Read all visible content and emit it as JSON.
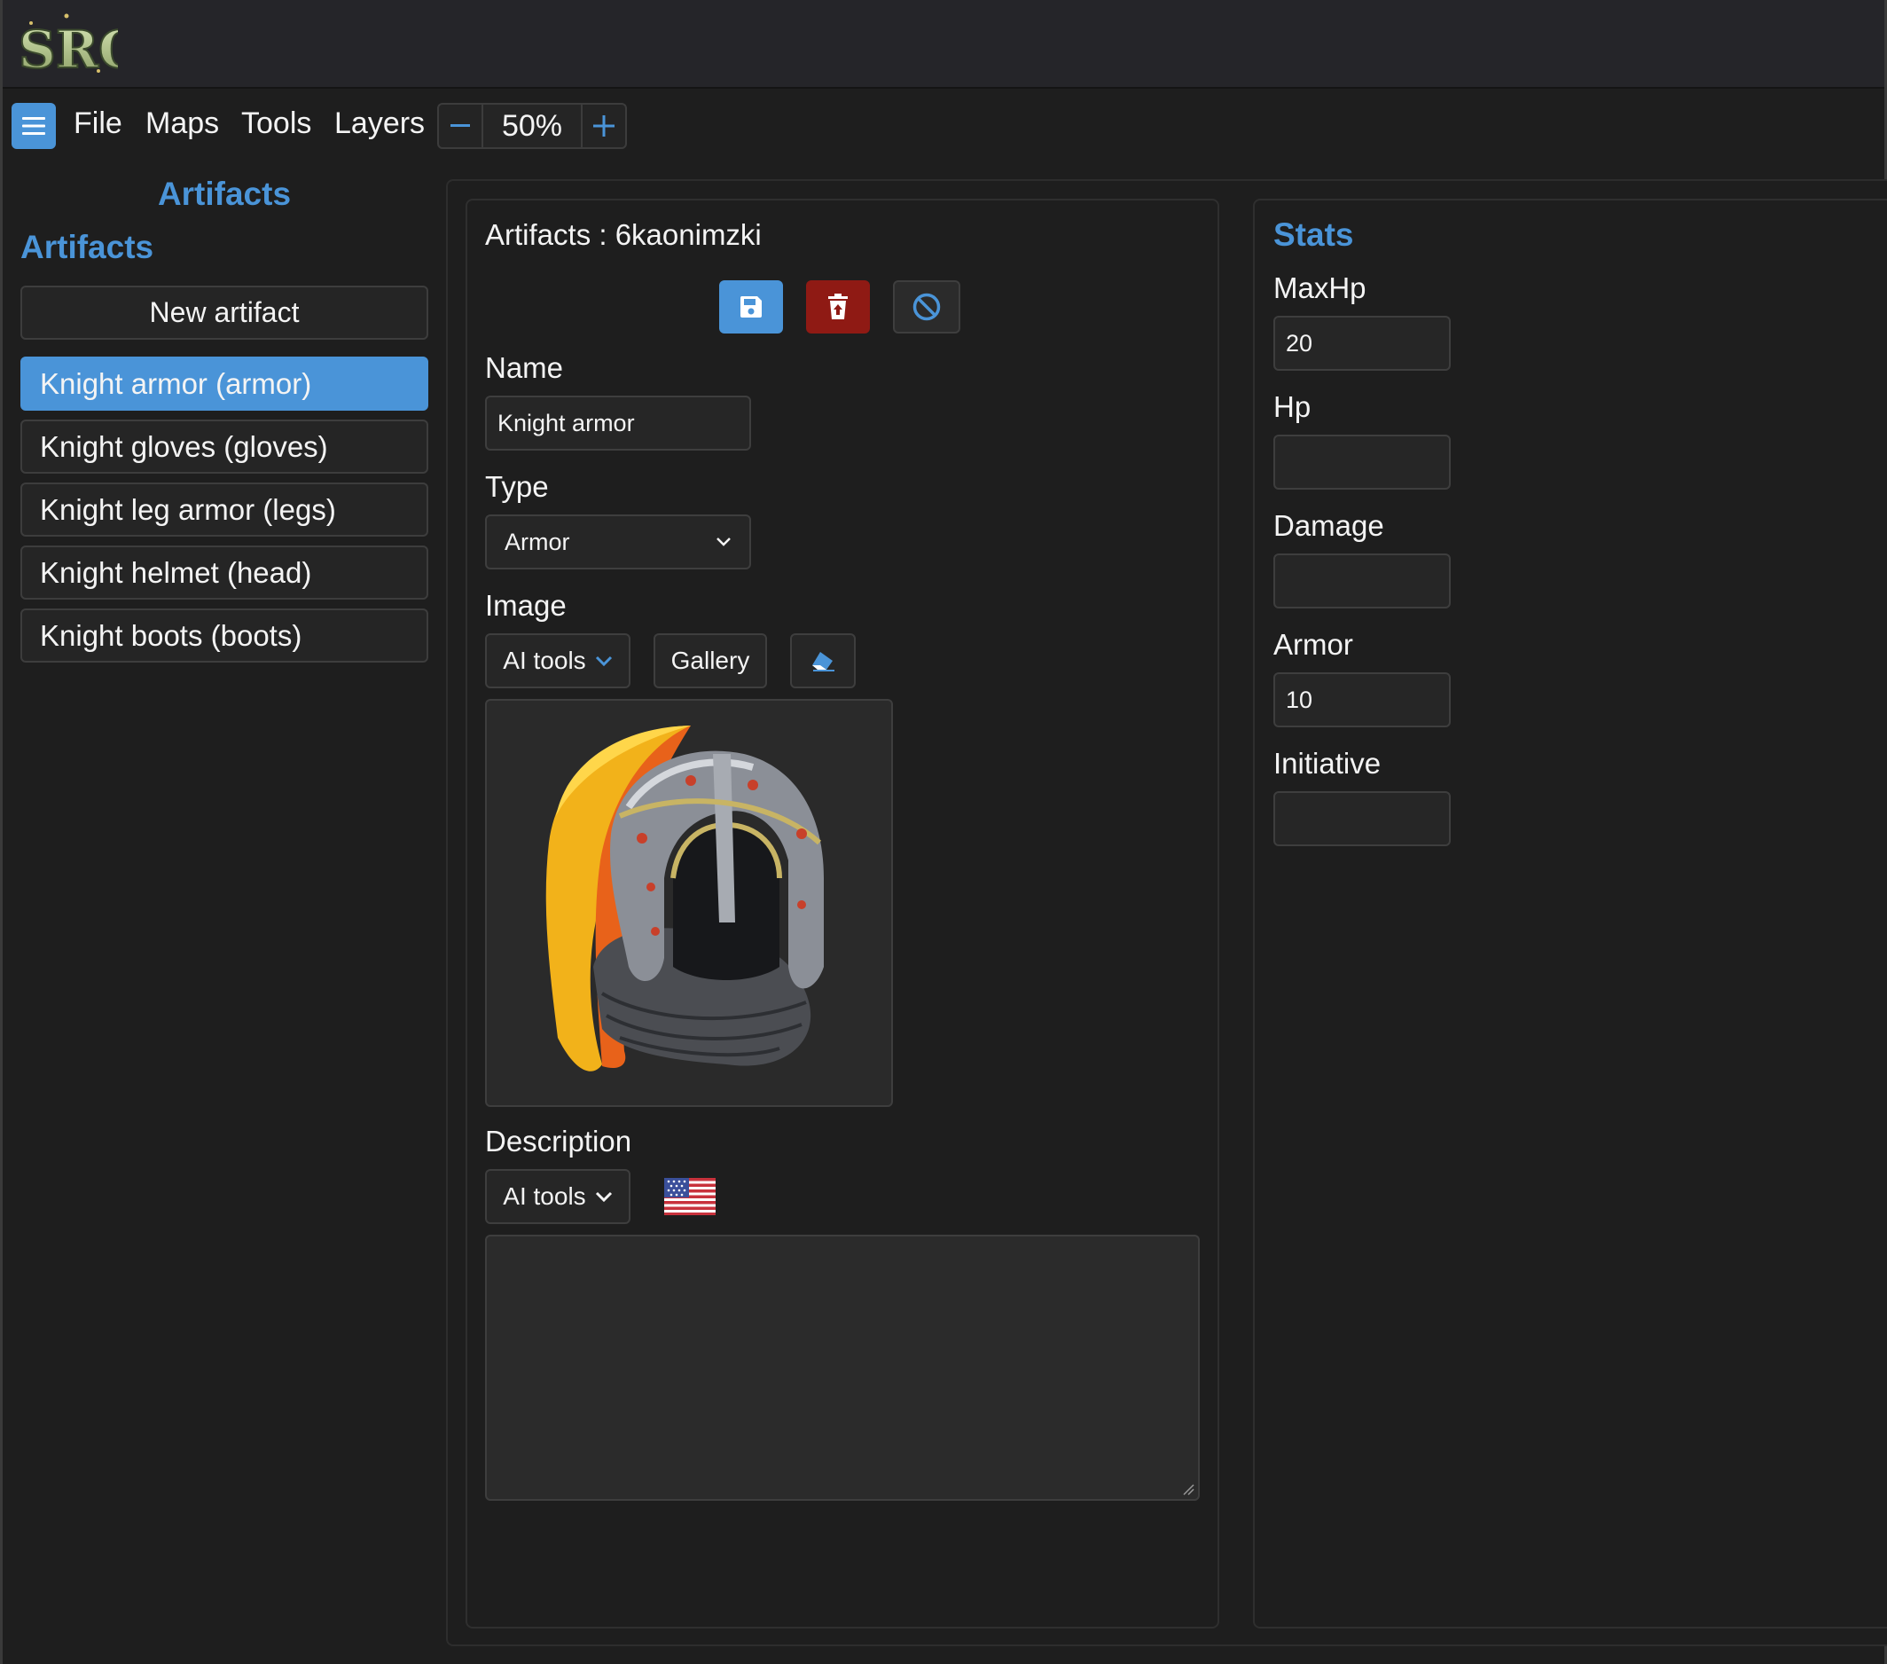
{
  "app": {
    "logo_text": "SRQ"
  },
  "menu": {
    "items": [
      "File",
      "Maps",
      "Tools",
      "Layers"
    ],
    "zoom_value": "50%"
  },
  "sidebar": {
    "title": "Artifacts",
    "subtitle": "Artifacts",
    "new_button": "New artifact",
    "items": [
      {
        "label": "Knight armor (armor)",
        "active": true
      },
      {
        "label": "Knight gloves (gloves)",
        "active": false
      },
      {
        "label": "Knight leg armor (legs)",
        "active": false
      },
      {
        "label": "Knight helmet (head)",
        "active": false
      },
      {
        "label": "Knight boots (boots)",
        "active": false
      }
    ]
  },
  "editor": {
    "heading": "Artifacts : 6kaonimzki",
    "name_label": "Name",
    "name_value": "Knight armor",
    "type_label": "Type",
    "type_value": "Armor",
    "image_label": "Image",
    "ai_tools_label": "AI tools",
    "gallery_label": "Gallery",
    "description_label": "Description",
    "description_ai_tools_label": "AI tools",
    "description_value": "",
    "description_language_icon": "us-flag-icon"
  },
  "stats": {
    "heading": "Stats",
    "fields": [
      {
        "label": "MaxHp",
        "value": "20"
      },
      {
        "label": "Hp",
        "value": ""
      },
      {
        "label": "Damage",
        "value": ""
      },
      {
        "label": "Armor",
        "value": "10"
      },
      {
        "label": "Initiative",
        "value": ""
      }
    ]
  },
  "colors": {
    "accent": "#4a94d8",
    "danger": "#8f1a14",
    "background": "#1e1e1e"
  }
}
